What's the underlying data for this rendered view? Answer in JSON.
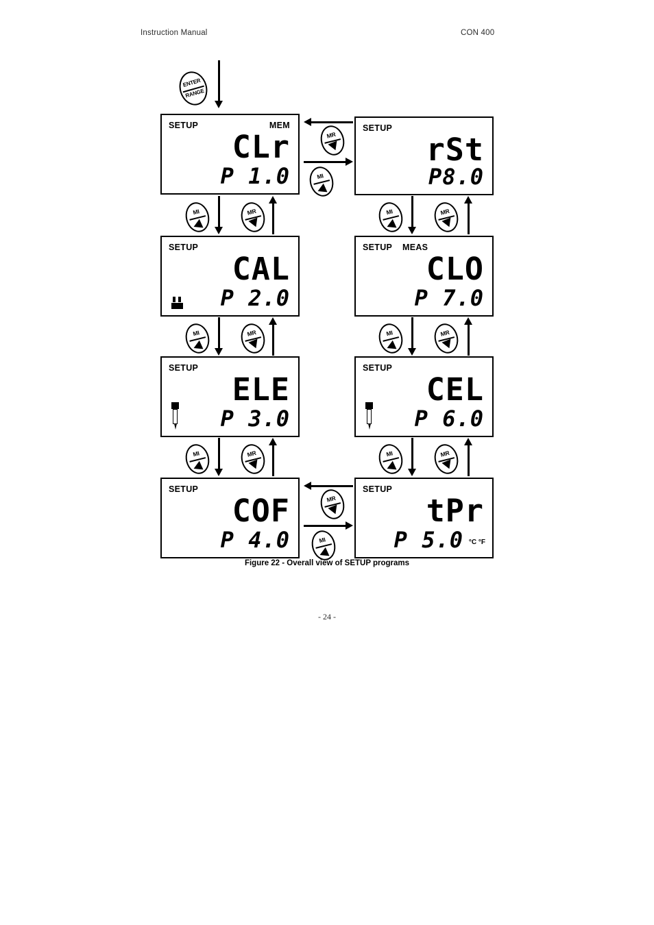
{
  "header": {
    "left": "Instruction Manual",
    "right": "CON 400"
  },
  "figure": {
    "caption": "Figure 22 - Overall view of SETUP programs"
  },
  "folio": "- 24 -",
  "keys": {
    "enter": {
      "top_label": "ENTER",
      "bottom_label": "RANGE"
    },
    "mi": {
      "label": "MI",
      "direction": "up"
    },
    "mr": {
      "label": "MR",
      "direction": "down"
    }
  },
  "displays": [
    {
      "id": "clr",
      "annunciators": [
        "SETUP",
        "MEM"
      ],
      "main": "CLr",
      "program": "P 1.0",
      "icon": "none",
      "units": ""
    },
    {
      "id": "rst",
      "annunciators": [
        "SETUP"
      ],
      "main": "rSt",
      "program": "P8.0",
      "icon": "none",
      "units": ""
    },
    {
      "id": "cal",
      "annunciators": [
        "SETUP"
      ],
      "main": "CAL",
      "program": "P 2.0",
      "icon": "beaker-icon",
      "units": ""
    },
    {
      "id": "clo",
      "annunciators": [
        "SETUP",
        "MEAS"
      ],
      "main": "CLO",
      "program": "P 7.0",
      "icon": "none",
      "units": ""
    },
    {
      "id": "ele",
      "annunciators": [
        "SETUP"
      ],
      "main": "ELE",
      "program": "P 3.0",
      "icon": "probe-icon",
      "units": ""
    },
    {
      "id": "cel",
      "annunciators": [
        "SETUP"
      ],
      "main": "CEL",
      "program": "P 6.0",
      "icon": "probe-icon",
      "units": ""
    },
    {
      "id": "cof",
      "annunciators": [
        "SETUP"
      ],
      "main": "COF",
      "program": "P 4.0",
      "icon": "none",
      "units": ""
    },
    {
      "id": "tpr",
      "annunciators": [
        "SETUP"
      ],
      "main": "tPr",
      "program": "P 5.0",
      "icon": "none",
      "units": "°C °F"
    }
  ],
  "labels": {
    "setup": "SETUP",
    "mem": "MEM",
    "meas": "MEAS"
  }
}
